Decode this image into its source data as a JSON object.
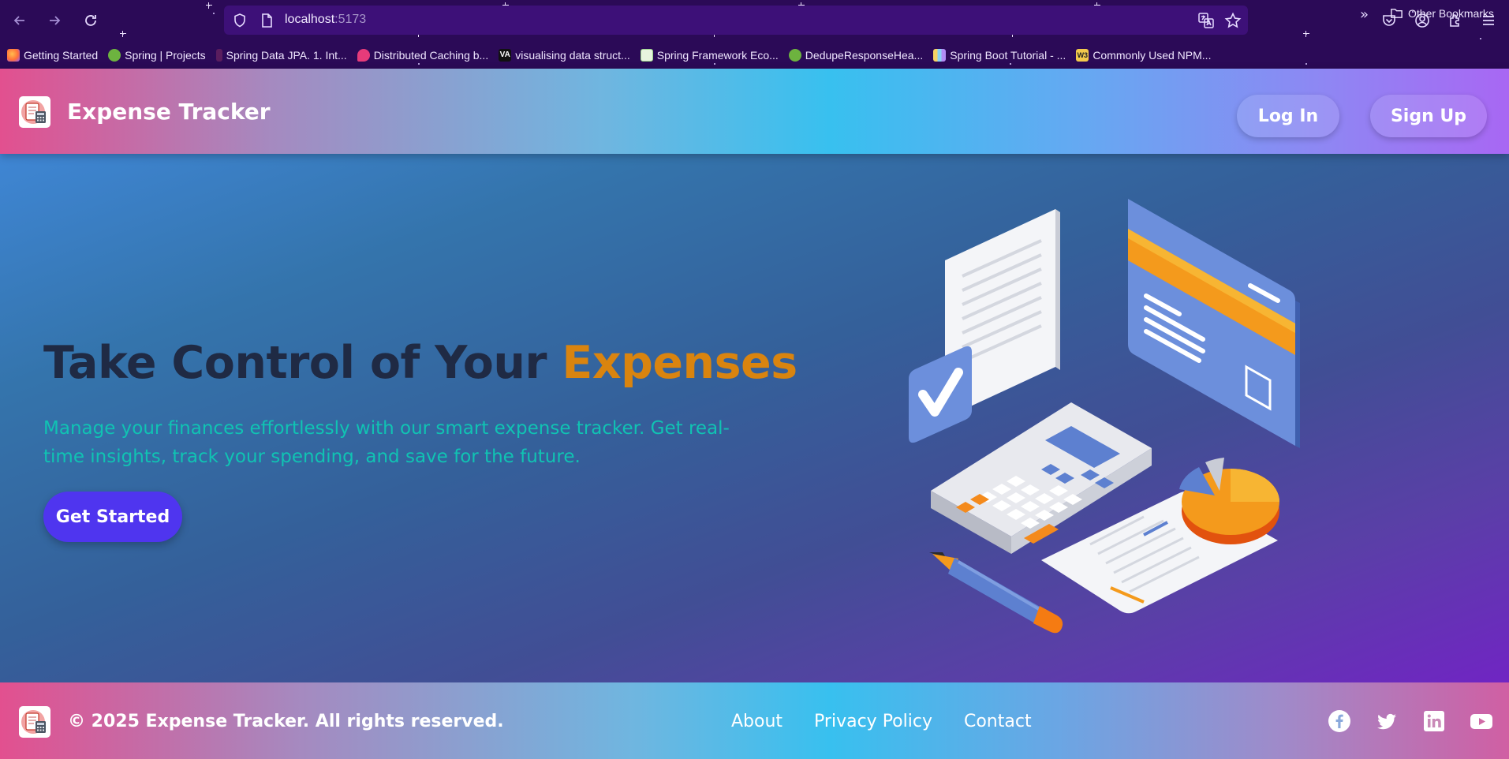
{
  "browser": {
    "url_host": "localhost",
    "url_port": ":5173",
    "bookmarks": [
      {
        "label": "Getting Started",
        "icon": "firefox-icon",
        "color": "#ff7139"
      },
      {
        "label": "Spring | Projects",
        "icon": "spring-icon",
        "color": "#6db33f"
      },
      {
        "label": "Spring Data JPA. 1. Int...",
        "icon": "jpa-icon",
        "color": "#5a1d5e"
      },
      {
        "label": "Distributed Caching b...",
        "icon": "caching-icon",
        "color": "#e63b7a"
      },
      {
        "label": "visualising data struct...",
        "icon": "visualgo-icon",
        "color": "#111111"
      },
      {
        "label": "Spring Framework Eco...",
        "icon": "tree-icon",
        "color": "#9ad38a"
      },
      {
        "label": "DedupeResponseHea...",
        "icon": "spring-icon",
        "color": "#6db33f"
      },
      {
        "label": "Spring Boot Tutorial - ...",
        "icon": "chart-icon",
        "color": "#8ad3f5"
      },
      {
        "label": "Commonly Used NPM...",
        "icon": "w3-icon",
        "color": "#f2c94c"
      }
    ],
    "other_bookmarks": "Other Bookmarks"
  },
  "header": {
    "brand": "Expense Tracker",
    "login": "Log In",
    "signup": "Sign Up"
  },
  "hero": {
    "title_main": "Take Control of Your ",
    "title_accent": "Expenses",
    "subtitle": "Manage your finances effortlessly with our smart expense tracker. Get real-time insights, track your spending, and save for the future.",
    "cta": "Get Started"
  },
  "footer": {
    "copyright": "© 2025 Expense Tracker. All rights reserved.",
    "links": [
      "About",
      "Privacy Policy",
      "Contact"
    ],
    "social": [
      "facebook-icon",
      "twitter-icon",
      "linkedin-icon",
      "youtube-icon"
    ]
  },
  "colors": {
    "accent": "#d9840f",
    "subtitle": "#10c3b3",
    "cta": "#4f35ef",
    "title": "#1f2a44"
  }
}
